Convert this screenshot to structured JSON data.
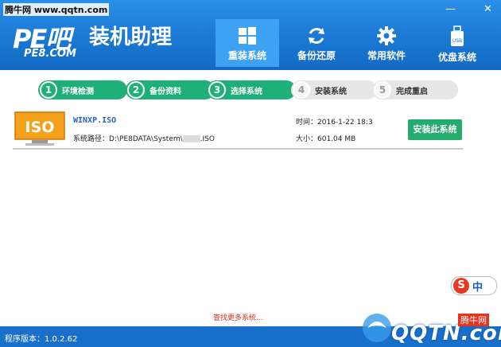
{
  "watermark_top": "腾牛网 www.qqtn.com",
  "logo": {
    "pe": "PE吧",
    "title": "装机助理",
    "sub": "PE8.COM"
  },
  "window_controls": {
    "minimize": "—",
    "close": "✕"
  },
  "nav": [
    {
      "label": "重装系统",
      "icon": "windows-icon",
      "active": true
    },
    {
      "label": "备份还原",
      "icon": "refresh-icon",
      "active": false
    },
    {
      "label": "常用软件",
      "icon": "gear-icon",
      "active": false
    },
    {
      "label": "优盘系统",
      "icon": "usb-icon",
      "active": false
    }
  ],
  "steps": [
    {
      "num": "1",
      "label": "环境检测",
      "done": true
    },
    {
      "num": "2",
      "label": "备份资料",
      "done": true
    },
    {
      "num": "3",
      "label": "选择系统",
      "done": true
    },
    {
      "num": "4",
      "label": "安装系统",
      "done": false
    },
    {
      "num": "5",
      "label": "完成重启",
      "done": false
    }
  ],
  "file": {
    "icon_text": "ISO",
    "name": "WINXP.ISO",
    "path_label": "系统路径：",
    "path_value": "D:\\PE8DATA\\System\\",
    "path_suffix": ".ISO",
    "time_label": "时间：",
    "time_value": "2016-1-22 18:3",
    "size_label": "大小：",
    "size_value": "601.04 MB",
    "install_button": "安装此系统"
  },
  "find_more": "查找更多系统...",
  "version_label": "程序版本：",
  "version_value": "1.0.2.62",
  "ime": {
    "logo": "S",
    "mode": "中"
  },
  "watermark_bottom": {
    "text": "QQTN.com",
    "tag": "腾牛网"
  },
  "colors": {
    "header": "#1a78d4",
    "step_done": "#1fb077",
    "install": "#23ac6e",
    "link": "#e03020"
  }
}
